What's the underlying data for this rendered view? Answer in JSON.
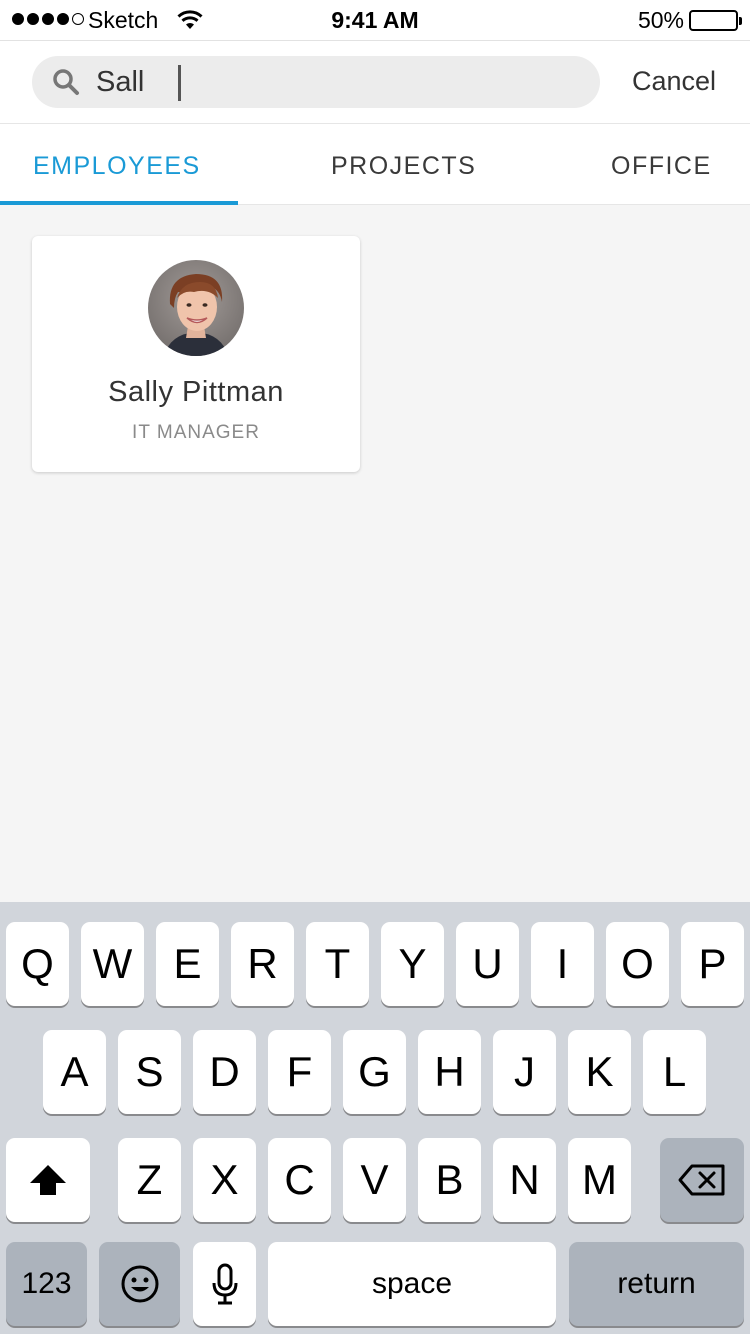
{
  "status_bar": {
    "carrier": "Sketch",
    "time": "9:41 AM",
    "battery_percent": "50%",
    "signal_bars_filled": 4,
    "signal_bars_total": 5,
    "battery_level": 0.5,
    "battery_color": "#ffcc00"
  },
  "search": {
    "value": "Sall",
    "icon": "search-icon",
    "cancel_label": "Cancel"
  },
  "tabs": [
    {
      "label": "EMPLOYEES",
      "active": true
    },
    {
      "label": "PROJECTS",
      "active": false
    },
    {
      "label": "OFFICE",
      "active": false
    }
  ],
  "colors": {
    "accent": "#1a9ad6",
    "keyboard_bg": "#d1d5db",
    "key_dark": "#acb3bc"
  },
  "results": [
    {
      "name": "Sally Pittman",
      "title": "IT MANAGER",
      "avatar": "avatar-photo"
    }
  ],
  "keyboard": {
    "row1": [
      "Q",
      "W",
      "E",
      "R",
      "T",
      "Y",
      "U",
      "I",
      "O",
      "P"
    ],
    "row2": [
      "A",
      "S",
      "D",
      "F",
      "G",
      "H",
      "J",
      "K",
      "L"
    ],
    "row3": [
      "Z",
      "X",
      "C",
      "V",
      "B",
      "N",
      "M"
    ],
    "numbers_label": "123",
    "space_label": "space",
    "return_label": "return",
    "shift_icon": "shift-icon",
    "delete_icon": "delete-icon",
    "emoji_icon": "emoji-icon",
    "mic_icon": "microphone-icon"
  }
}
